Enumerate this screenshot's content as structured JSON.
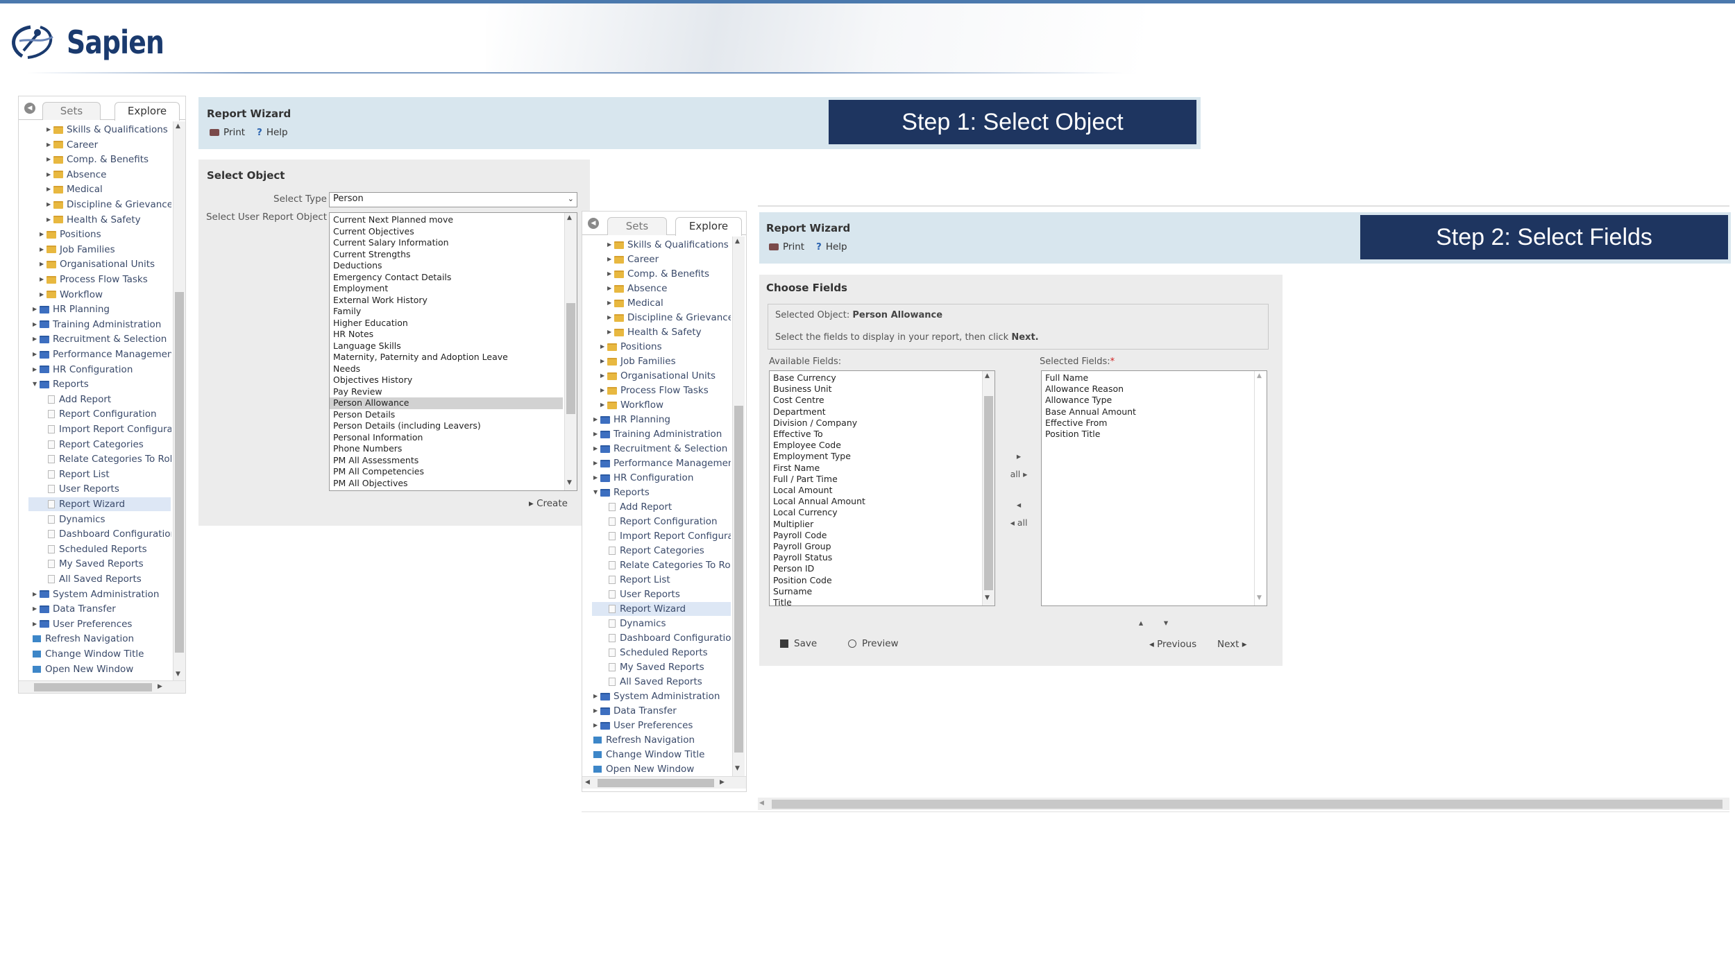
{
  "brand": {
    "name": "Sapien"
  },
  "sidebar": {
    "tabs": [
      "Sets",
      "Explore"
    ],
    "items": [
      {
        "label": "Skills & Qualifications",
        "level": 2,
        "kind": "folder"
      },
      {
        "label": "Career",
        "level": 2,
        "kind": "folder"
      },
      {
        "label": "Comp. & Benefits",
        "level": 2,
        "kind": "folder"
      },
      {
        "label": "Absence",
        "level": 2,
        "kind": "folder"
      },
      {
        "label": "Medical",
        "level": 2,
        "kind": "folder"
      },
      {
        "label": "Discipline & Grievance",
        "level": 2,
        "kind": "folder"
      },
      {
        "label": "Health & Safety",
        "level": 2,
        "kind": "folder"
      },
      {
        "label": "Positions",
        "level": 1,
        "kind": "folder"
      },
      {
        "label": "Job Families",
        "level": 1,
        "kind": "folder"
      },
      {
        "label": "Organisational Units",
        "level": 1,
        "kind": "folder"
      },
      {
        "label": "Process Flow Tasks",
        "level": 1,
        "kind": "folder"
      },
      {
        "label": "Workflow",
        "level": 1,
        "kind": "folder"
      },
      {
        "label": "HR Planning",
        "level": 0,
        "kind": "module"
      },
      {
        "label": "Training Administration",
        "level": 0,
        "kind": "module"
      },
      {
        "label": "Recruitment & Selection",
        "level": 0,
        "kind": "module"
      },
      {
        "label": "Performance Management",
        "level": 0,
        "kind": "module"
      },
      {
        "label": "HR Configuration",
        "level": 0,
        "kind": "module"
      },
      {
        "label": "Reports",
        "level": 0,
        "kind": "module-open"
      },
      {
        "label": "Add Report",
        "level": 1,
        "kind": "doc"
      },
      {
        "label": "Report Configuration",
        "level": 1,
        "kind": "doc"
      },
      {
        "label": "Import Report Configuration",
        "level": 1,
        "kind": "doc"
      },
      {
        "label": "Report Categories",
        "level": 1,
        "kind": "doc"
      },
      {
        "label": "Relate Categories To Roles",
        "level": 1,
        "kind": "doc"
      },
      {
        "label": "Report List",
        "level": 1,
        "kind": "doc"
      },
      {
        "label": "User Reports",
        "level": 1,
        "kind": "doc"
      },
      {
        "label": "Report Wizard",
        "level": 1,
        "kind": "doc",
        "selected": true
      },
      {
        "label": "Dynamics",
        "level": 1,
        "kind": "doc"
      },
      {
        "label": "Dashboard Configuration",
        "level": 1,
        "kind": "doc"
      },
      {
        "label": "Scheduled Reports",
        "level": 1,
        "kind": "doc"
      },
      {
        "label": "My Saved Reports",
        "level": 1,
        "kind": "doc"
      },
      {
        "label": "All Saved Reports",
        "level": 1,
        "kind": "doc"
      },
      {
        "label": "System Administration",
        "level": 0,
        "kind": "module"
      },
      {
        "label": "Data Transfer",
        "level": 0,
        "kind": "module"
      },
      {
        "label": "User Preferences",
        "level": 0,
        "kind": "module"
      },
      {
        "label": "Refresh Navigation",
        "level": 0,
        "kind": "link"
      },
      {
        "label": "Change Window Title",
        "level": 0,
        "kind": "link"
      },
      {
        "label": "Open New Window",
        "level": 0,
        "kind": "link"
      }
    ]
  },
  "step1": {
    "title": "Report Wizard",
    "print": "Print",
    "help": "Help",
    "banner": "Step 1: Select Object",
    "section": "Select Object",
    "type_label": "Select Type",
    "type_value": "Person",
    "object_label": "Select User Report Object",
    "objects": [
      "Current Next Planned move",
      "Current Objectives",
      "Current Salary Information",
      "Current Strengths",
      "Deductions",
      "Emergency Contact Details",
      "Employment",
      "External Work History",
      "Family",
      "Higher Education",
      "HR Notes",
      "Language Skills",
      "Maternity, Paternity and Adoption Leave",
      "Needs",
      "Objectives History",
      "Pay Review",
      "Person Allowance",
      "Person Details",
      "Person Details (including Leavers)",
      "Personal Information",
      "Phone Numbers",
      "PM All Assessments",
      "PM All Competencies",
      "PM All Objectives"
    ],
    "selected_object": "Person Allowance",
    "create": "▸ Create"
  },
  "step2": {
    "title": "Report Wizard",
    "print": "Print",
    "help": "Help",
    "banner": "Step 2: Select Fields",
    "section": "Choose Fields",
    "selected_object_label": "Selected Object:",
    "selected_object": "Person Allowance",
    "instruction": "Select the fields to display in your report, then click",
    "instruction_next": "Next.",
    "available_label": "Available Fields:",
    "selected_label": "Selected Fields:",
    "required_mark": "*",
    "available": [
      "Base Currency",
      "Business Unit",
      "Cost Centre",
      "Department",
      "Division / Company",
      "Effective To",
      "Employee Code",
      "Employment Type",
      "First Name",
      "Full / Part Time",
      "Local Amount",
      "Local Annual Amount",
      "Local Currency",
      "Multiplier",
      "Payroll Code",
      "Payroll Group",
      "Payroll Status",
      "Person ID",
      "Position Code",
      "Surname",
      "Title"
    ],
    "selected": [
      "Full Name",
      "Allowance Reason",
      "Allowance Type",
      "Base Annual Amount",
      "Effective From",
      "Position Title"
    ],
    "move_right": "▸",
    "move_all_right": "all ▸",
    "move_left": "◂",
    "move_all_left": "◂ all",
    "move_up": "▴",
    "move_down": "▾",
    "save": "Save",
    "preview": "Preview",
    "previous": "◂ Previous",
    "next": "Next ▸"
  },
  "colors": {
    "banner": "#1e3560",
    "header": "#d8e6ee",
    "panel": "#ececec",
    "accent": "#4b79ad"
  }
}
